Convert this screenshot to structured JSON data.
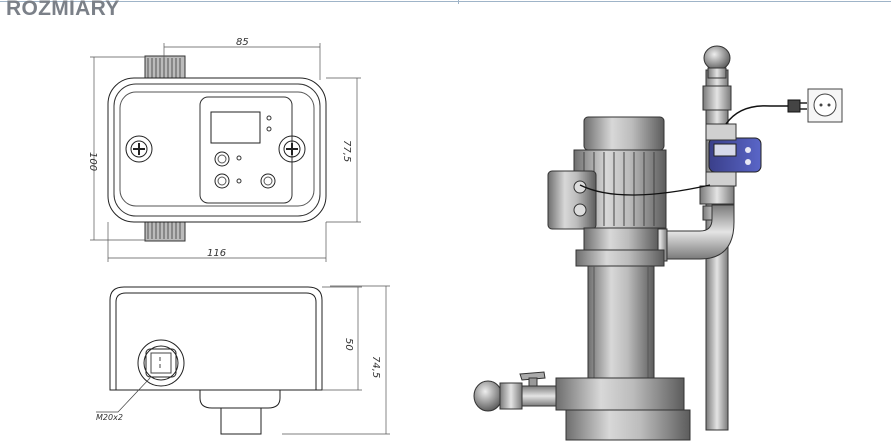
{
  "header": {
    "title": "ROZMIARY"
  },
  "dimensions": {
    "top_width": "85",
    "left_height": "100",
    "right_height": "77,5",
    "bottom_width": "116",
    "side_height_inner": "50",
    "side_height_outer": "74,5",
    "thread": "M20x2"
  }
}
